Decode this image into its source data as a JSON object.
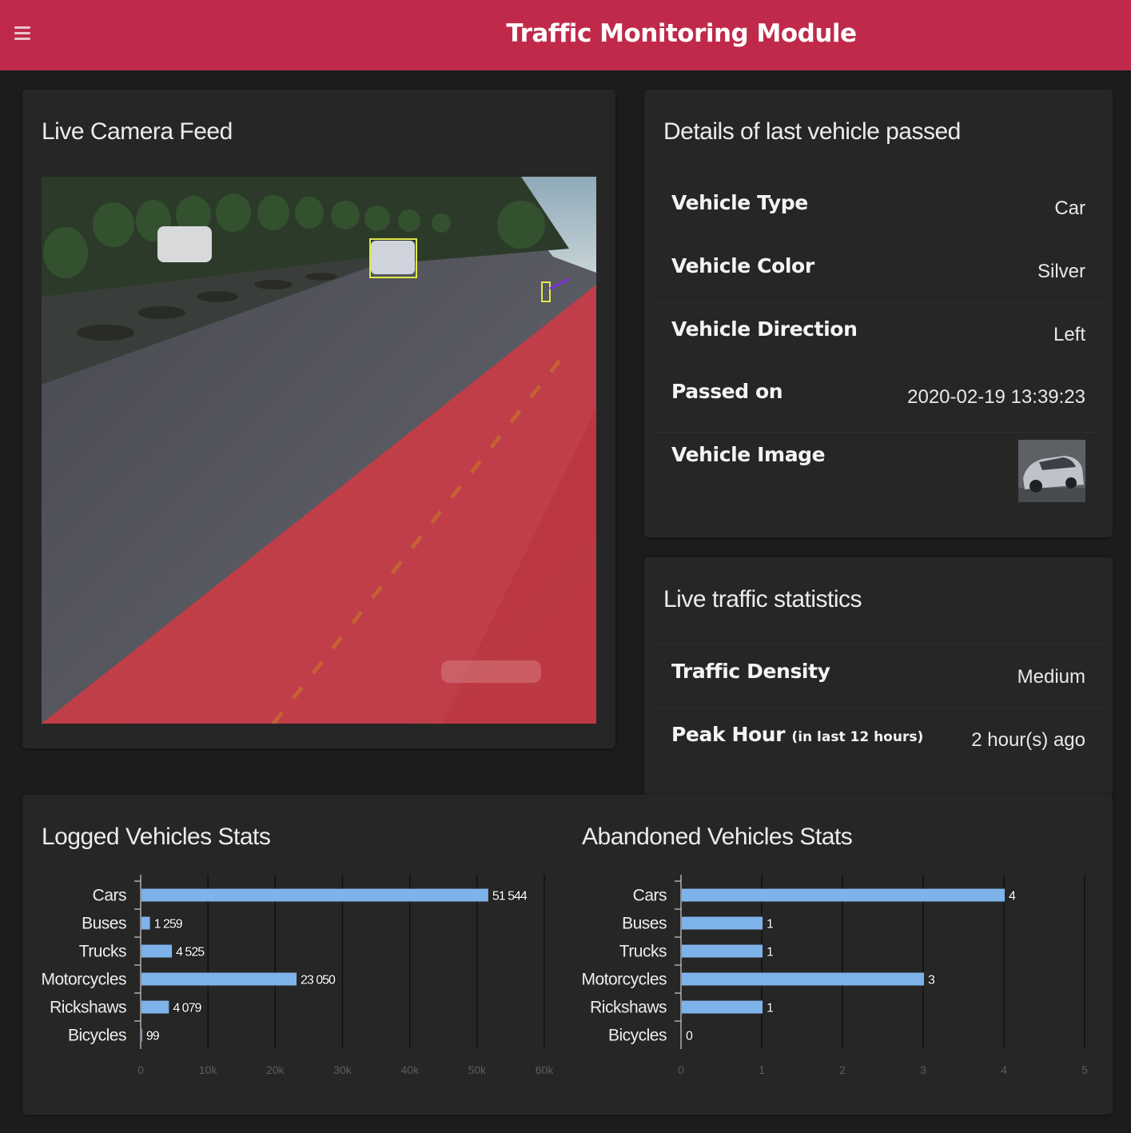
{
  "header": {
    "title": "Traffic Monitoring Module",
    "menu_icon": "hamburger-menu-icon"
  },
  "camera": {
    "title": "Live Camera Feed"
  },
  "details": {
    "title": "Details of last vehicle passed",
    "rows": [
      {
        "key": "Vehicle Type",
        "value": "Car"
      },
      {
        "key": "Vehicle Color",
        "value": "Silver"
      },
      {
        "key": "Vehicle Direction",
        "value": "Left"
      },
      {
        "key": "Passed on",
        "value": "2020-02-19 13:39:23"
      }
    ],
    "image_label": "Vehicle Image"
  },
  "stats": {
    "title": "Live traffic statistics",
    "density_label": "Traffic Density",
    "density_value": "Medium",
    "peak_label": "Peak Hour",
    "peak_note": "(in last 12 hours)",
    "peak_value": "2 hour(s) ago"
  },
  "colors": {
    "header": "#c0294a",
    "bar": "#7eb3ea",
    "card": "#262626",
    "background": "#1c1c1c"
  },
  "chart_data": [
    {
      "type": "bar",
      "orientation": "horizontal",
      "title": "Logged Vehicles Stats",
      "categories": [
        "Cars",
        "Buses",
        "Trucks",
        "Motorcycles",
        "Rickshaws",
        "Bicycles"
      ],
      "values": [
        51544,
        1259,
        4525,
        23050,
        4079,
        99
      ],
      "value_labels": [
        "51 544",
        "1 259",
        "4 525",
        "23 050",
        "4 079",
        "99"
      ],
      "xlim": [
        0,
        60000
      ],
      "ticks": [
        0,
        10000,
        20000,
        30000,
        40000,
        50000,
        60000
      ],
      "tick_labels": [
        "0",
        "10k",
        "20k",
        "30k",
        "40k",
        "50k",
        "60k"
      ],
      "grid": true
    },
    {
      "type": "bar",
      "orientation": "horizontal",
      "title": "Abandoned Vehicles Stats",
      "categories": [
        "Cars",
        "Buses",
        "Trucks",
        "Motorcycles",
        "Rickshaws",
        "Bicycles"
      ],
      "values": [
        4,
        1,
        1,
        3,
        1,
        0
      ],
      "value_labels": [
        "4",
        "1",
        "1",
        "3",
        "1",
        "0"
      ],
      "xlim": [
        0,
        5
      ],
      "ticks": [
        0,
        1,
        2,
        3,
        4,
        5
      ],
      "tick_labels": [
        "0",
        "1",
        "2",
        "3",
        "4",
        "5"
      ],
      "grid": true
    }
  ]
}
